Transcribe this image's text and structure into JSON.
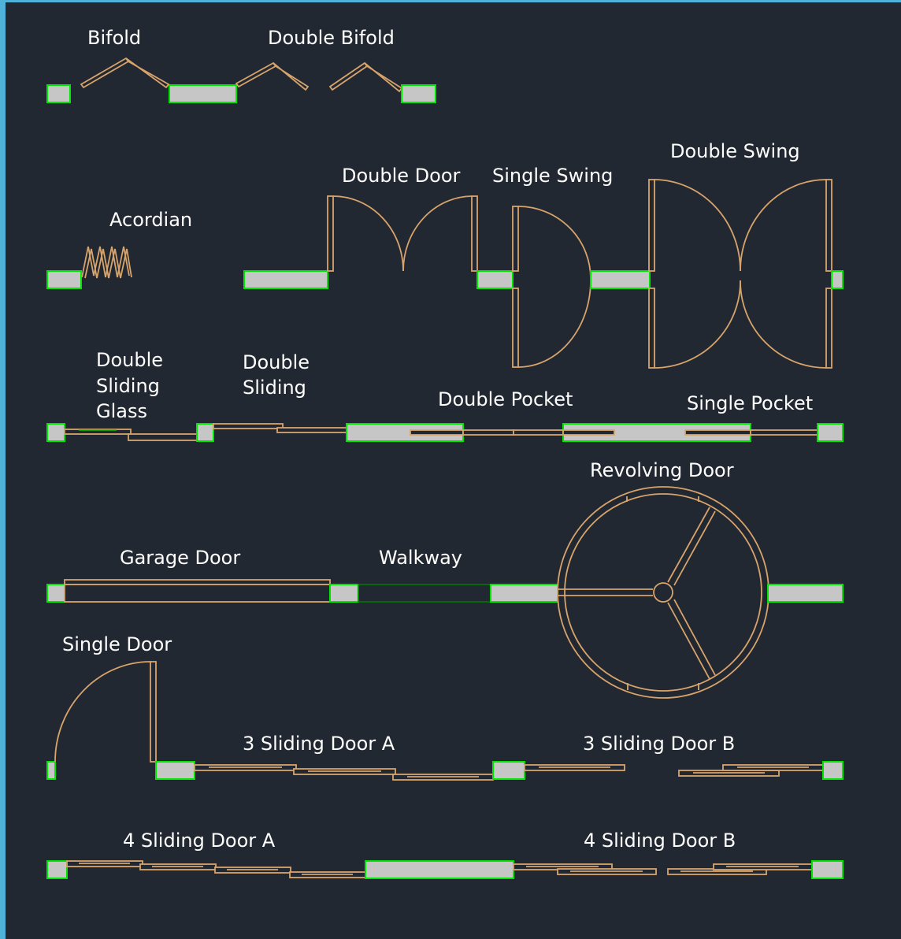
{
  "labels": {
    "bifold": "Bifold",
    "double_bifold": "Double Bifold",
    "acordian": "Acordian",
    "double_door": "Double Door",
    "single_swing": "Single Swing",
    "double_swing": "Double Swing",
    "double_sliding_glass_1": "Double",
    "double_sliding_glass_2": "Sliding",
    "double_sliding_glass_3": "Glass",
    "double_sliding_1": "Double",
    "double_sliding_2": "Sliding",
    "double_pocket": "Double Pocket",
    "single_pocket": "Single Pocket",
    "revolving_door": "Revolving Door",
    "garage_door": "Garage Door",
    "walkway": "Walkway",
    "single_door": "Single Door",
    "three_sliding_a": "3 Sliding Door A",
    "three_sliding_b": "3 Sliding Door B",
    "four_sliding_a": "4 Sliding Door A",
    "four_sliding_b": "4 Sliding Door B"
  },
  "colors": {
    "background": "#222831",
    "wall_fill": "#c6c6c6",
    "wall_outline": "#00e600",
    "door_line": "#d8a46c",
    "frame_border": "#4fb3d9"
  }
}
